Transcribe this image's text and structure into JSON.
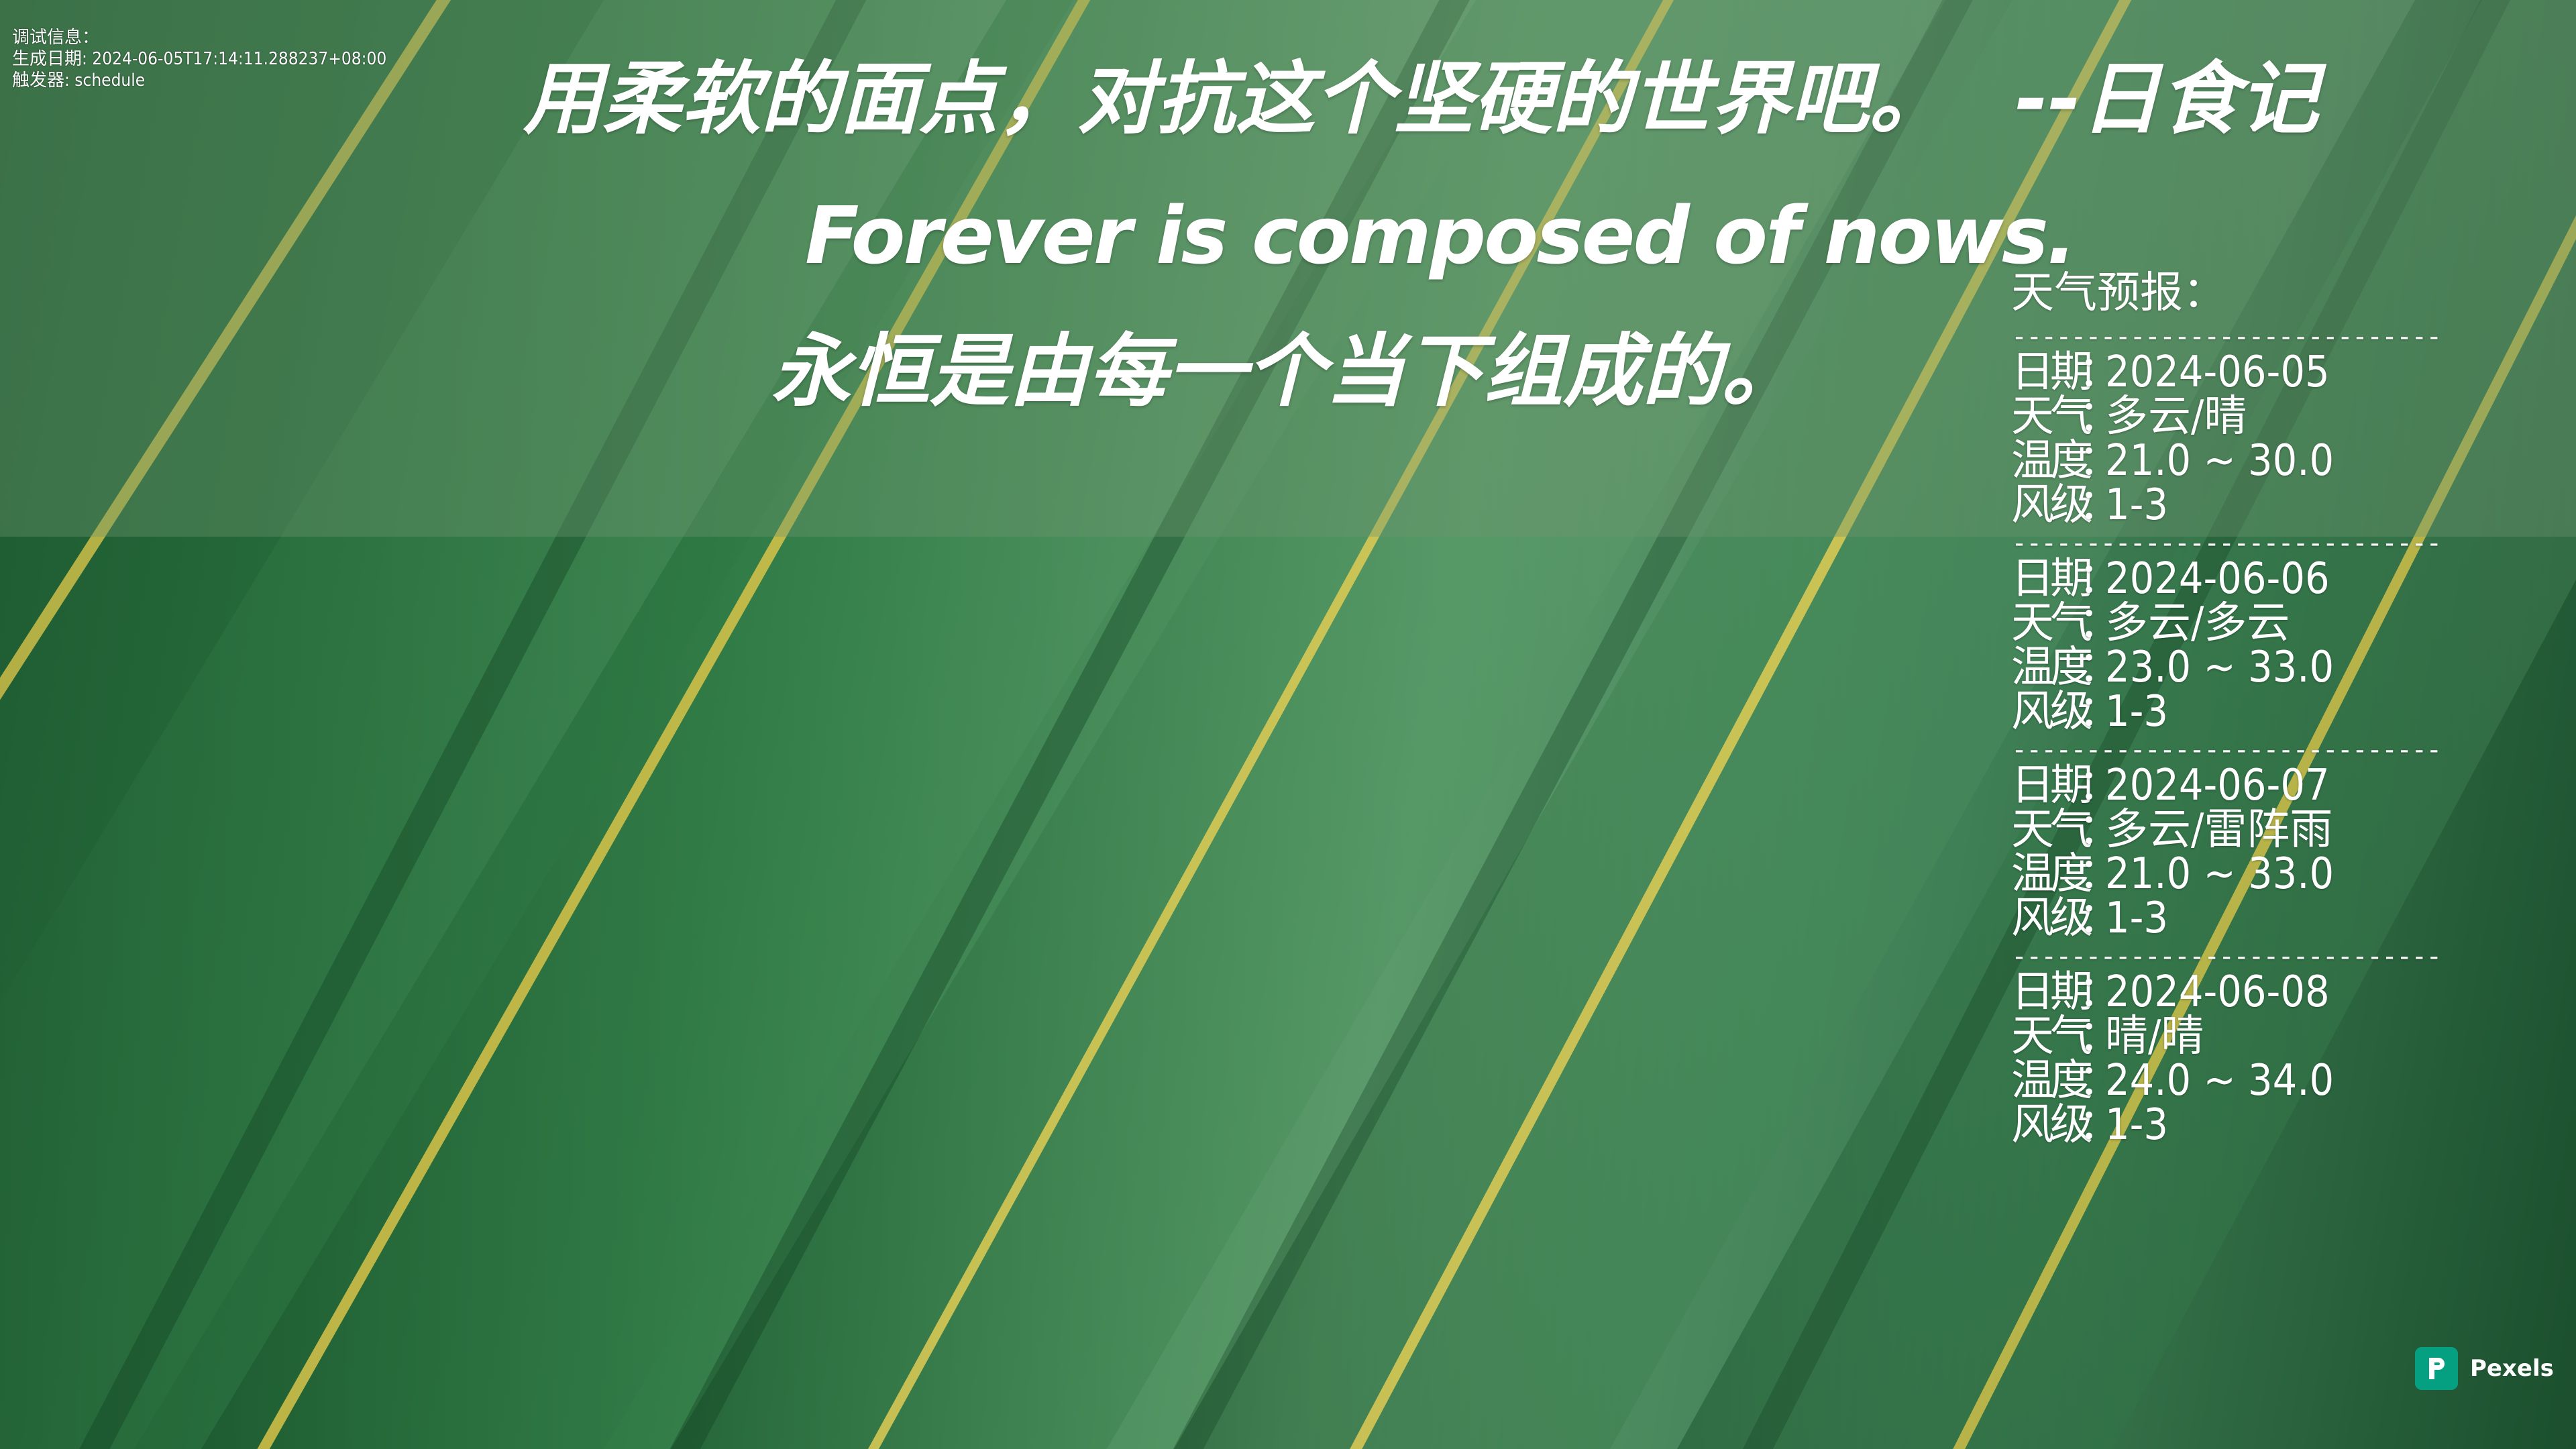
{
  "debug": {
    "line1": "调试信息：",
    "line2": "生成日期: 2024-06-05T17:14:11.288237+08:00",
    "line3": "触发器: schedule"
  },
  "quote": {
    "chinese": "用柔软的面点，对抗这个坚硬的世界吧。",
    "author": "--日食记",
    "english": "Forever is composed of nows.",
    "english_translation": "永恒是由每一个当下组成的。"
  },
  "weather": {
    "title": "天气预报：",
    "separator": "-----------------------------",
    "labels": {
      "date": "日期",
      "weather": "天气",
      "temperature": "温度",
      "wind": "风级",
      "colon": "："
    },
    "days": [
      {
        "date": "2024-06-05",
        "weather": "多云/晴",
        "temperature": "21.0 ~ 30.0",
        "wind": "1-3"
      },
      {
        "date": "2024-06-06",
        "weather": "多云/多云",
        "temperature": "23.0 ~ 33.0",
        "wind": "1-3"
      },
      {
        "date": "2024-06-07",
        "weather": "多云/雷阵雨",
        "temperature": "21.0 ~ 33.0",
        "wind": "1-3"
      },
      {
        "date": "2024-06-08",
        "weather": "晴/晴",
        "temperature": "24.0 ~ 34.0",
        "wind": "1-3"
      }
    ]
  },
  "badge": {
    "label": "Pexels",
    "logo_icon": "pexels-logo-icon",
    "logo_color": "#05a081"
  }
}
